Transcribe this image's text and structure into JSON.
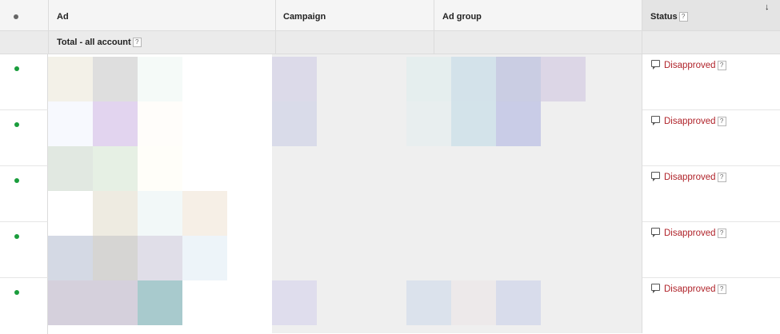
{
  "header": {
    "columns": [
      "Ad",
      "Campaign",
      "Ad group",
      "Status"
    ],
    "sort_indicator": "↓",
    "help_icon": "?"
  },
  "total_row": {
    "label": "Total - all account"
  },
  "rows": [
    {
      "status": "Disapproved"
    },
    {
      "status": "Disapproved"
    },
    {
      "status": "Disapproved"
    },
    {
      "status": "Disapproved"
    },
    {
      "status": "Disapproved"
    }
  ],
  "colors": {
    "status_text": "#b0232a",
    "enabled_dot": "#1a9d3c",
    "header_bg": "#f5f5f5",
    "total_bg": "#ebebeb"
  }
}
